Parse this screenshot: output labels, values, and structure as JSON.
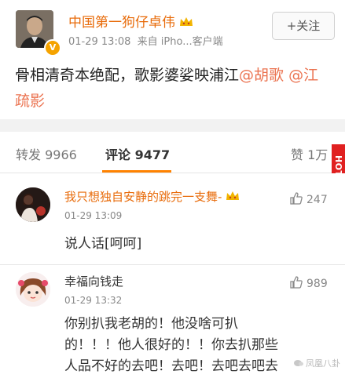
{
  "post": {
    "author": "中国第一狗仔卓伟",
    "time": "01-29 13:08",
    "source": "来自 iPho...客户端",
    "follow_label": "+关注",
    "text_main": "骨相清奇本绝配，歌影婆娑映浦江",
    "mention1": "@胡歌",
    "mention2": "@江疏影"
  },
  "tabs": {
    "repost": "转发 9966",
    "comment": "评论 9477",
    "like": "赞 1万"
  },
  "side_watermark": "HOTHK.COM",
  "comments": [
    {
      "name": "我只想独自安静的跳完一支舞-",
      "time": "01-29 13:09",
      "likes": "247",
      "text": "说人话[呵呵]"
    },
    {
      "name": "幸福向钱走",
      "time": "01-29 13:32",
      "likes": "989",
      "text_line1": "你别扒我老胡的！他没啥可扒",
      "text_line2": "的！！！他人很好的！！你去扒那些",
      "text_line3": "人品不好的去吧！去吧！去吧去吧去"
    }
  ],
  "bottom_watermark": "凤凰八卦"
}
